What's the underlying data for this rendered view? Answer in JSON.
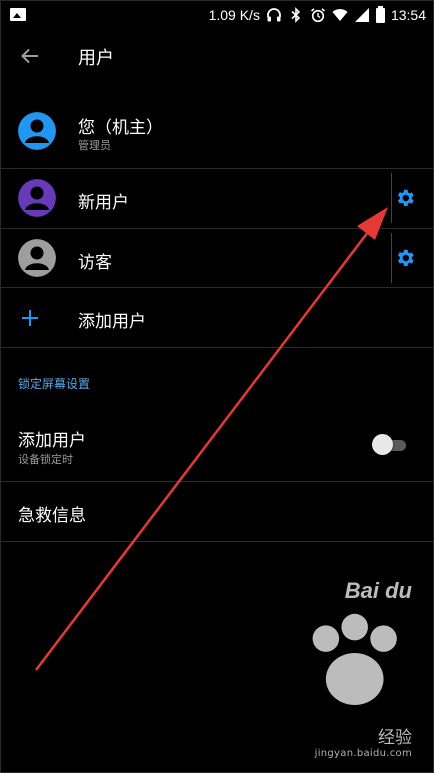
{
  "status_bar": {
    "speed": "1.09 K/s",
    "time": "13:54"
  },
  "toolbar": {
    "title": "用户"
  },
  "users": [
    {
      "name": "您（机主）",
      "role": "管理员",
      "avatar_color": "#2196f3",
      "has_settings": false
    },
    {
      "name": "新用户",
      "role": "",
      "avatar_color": "#673ab7",
      "has_settings": true
    },
    {
      "name": "访客",
      "role": "",
      "avatar_color": "#9e9e9e",
      "has_settings": true
    }
  ],
  "add_user": {
    "label": "添加用户"
  },
  "lock_screen": {
    "header": "锁定屏幕设置",
    "add_user_title": "添加用户",
    "add_user_subtitle": "设备锁定时",
    "add_user_toggle_on": false,
    "emergency_info": "急救信息"
  },
  "watermark": {
    "logo": "Bai du",
    "brand": "经验",
    "url": "jingyan.baidu.com"
  },
  "colors": {
    "accent": "#2196f3",
    "section": "#5aa7e6",
    "annotation_arrow": "#e53935"
  }
}
